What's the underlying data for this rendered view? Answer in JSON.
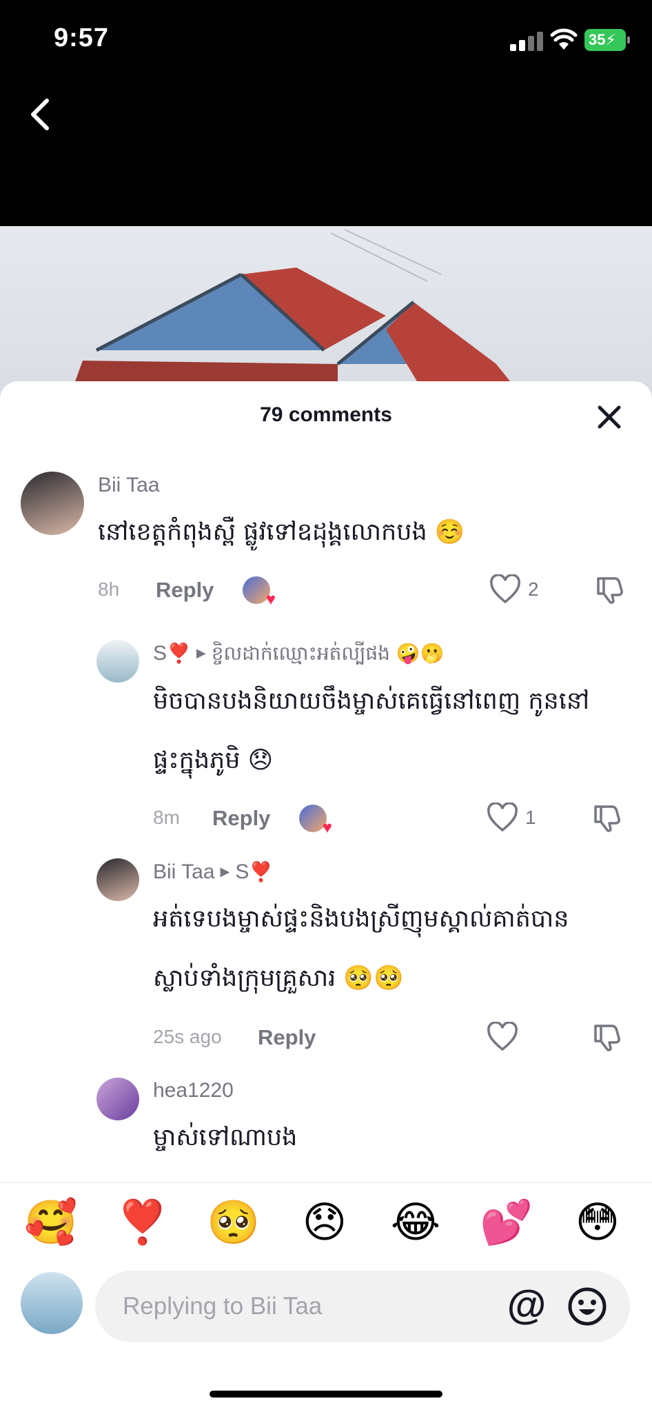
{
  "status_bar": {
    "time": "9:57",
    "battery": "35"
  },
  "sheet": {
    "title": "79 comments"
  },
  "comments": [
    {
      "username": "Bii Taa",
      "text_lines": [
        "នៅខេត្តកំពុងស្ពឺ ផ្លូវទៅឧដុង្គលោកបង ☺️"
      ],
      "time": "8h",
      "reply_label": "Reply",
      "likes": "2"
    },
    {
      "username": "S",
      "username_mark": "❣️",
      "reply_to": "ខ្ចិលដាក់ឈ្មោះអត់ល្បីផង 🤪🫢",
      "text_lines": [
        "មិចបានបងនិយាយចឹងម្ចាស់គេធ្វើនៅពេញ កូននៅ",
        "ផ្ទះក្នុងភូមិ 😞"
      ],
      "time": "8m",
      "reply_label": "Reply",
      "likes": "1"
    },
    {
      "username": "Bii Taa",
      "reply_to": "S",
      "reply_to_mark": "❣️",
      "text_lines": [
        "អត់ទេបងម្ចាស់ផ្ទះនិងបងស្រីញុមស្គាល់គាត់បាន",
        "ស្លាប់ទាំងក្រុមគ្រួសារ 🥺🥺"
      ],
      "time": "25s ago",
      "reply_label": "Reply"
    },
    {
      "username": "hea1220",
      "text_lines": [
        "ម្ចាស់ទៅណាបង"
      ]
    }
  ],
  "emoji_bar": [
    "🥰",
    "❣️",
    "🥺",
    "😞",
    "😂",
    "💕",
    "😳"
  ],
  "input": {
    "placeholder": "Replying to Bii Taa",
    "at_symbol": "@"
  },
  "colors": {
    "accent": "#fe2c55",
    "sheet_bg": "#ffffff",
    "input_bg": "#f1f1f2",
    "battery": "#35c759"
  }
}
